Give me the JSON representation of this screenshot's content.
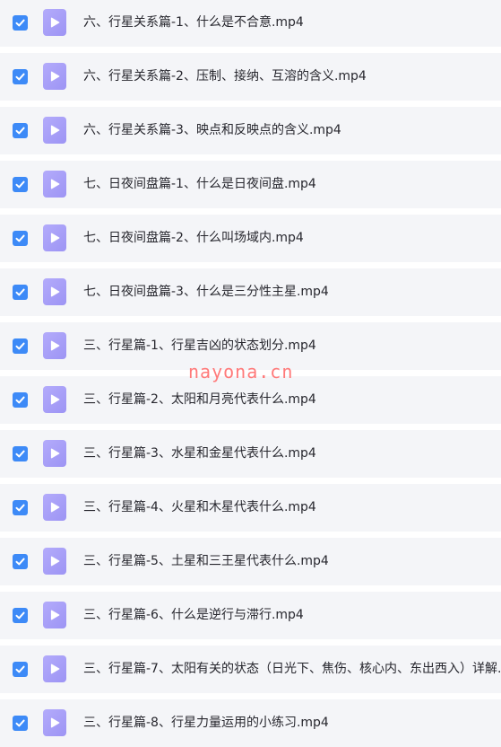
{
  "colors": {
    "row_background": "#f4f5f8",
    "checkbox": "#3d8af7",
    "file_icon": "#a89ff7",
    "text": "#27272e",
    "watermark": "#ff7a7a"
  },
  "files": [
    {
      "name": "六、行星关系篇-1、什么是不合意.mp4",
      "checked": true,
      "icon": "video-file-icon"
    },
    {
      "name": "六、行星关系篇-2、压制、接纳、互溶的含义.mp4",
      "checked": true,
      "icon": "video-file-icon"
    },
    {
      "name": "六、行星关系篇-3、映点和反映点的含义.mp4",
      "checked": true,
      "icon": "video-file-icon"
    },
    {
      "name": "七、日夜间盘篇-1、什么是日夜间盘.mp4",
      "checked": true,
      "icon": "video-file-icon"
    },
    {
      "name": "七、日夜间盘篇-2、什么叫场域内.mp4",
      "checked": true,
      "icon": "video-file-icon"
    },
    {
      "name": "七、日夜间盘篇-3、什么是三分性主星.mp4",
      "checked": true,
      "icon": "video-file-icon"
    },
    {
      "name": "三、行星篇-1、行星吉凶的状态划分.mp4",
      "checked": true,
      "icon": "video-file-icon"
    },
    {
      "name": "三、行星篇-2、太阳和月亮代表什么.mp4",
      "checked": true,
      "icon": "video-file-icon"
    },
    {
      "name": "三、行星篇-3、水星和金星代表什么.mp4",
      "checked": true,
      "icon": "video-file-icon"
    },
    {
      "name": "三、行星篇-4、火星和木星代表什么.mp4",
      "checked": true,
      "icon": "video-file-icon"
    },
    {
      "name": "三、行星篇-5、土星和三王星代表什么.mp4",
      "checked": true,
      "icon": "video-file-icon"
    },
    {
      "name": "三、行星篇-6、什么是逆行与滞行.mp4",
      "checked": true,
      "icon": "video-file-icon"
    },
    {
      "name": "三、行星篇-7、太阳有关的状态（日光下、焦伤、核心内、东出西入）详解.",
      "checked": true,
      "icon": "video-file-icon"
    },
    {
      "name": "三、行星篇-8、行星力量运用的小练习.mp4",
      "checked": true,
      "icon": "video-file-icon"
    }
  ],
  "watermark": "nayona.cn"
}
